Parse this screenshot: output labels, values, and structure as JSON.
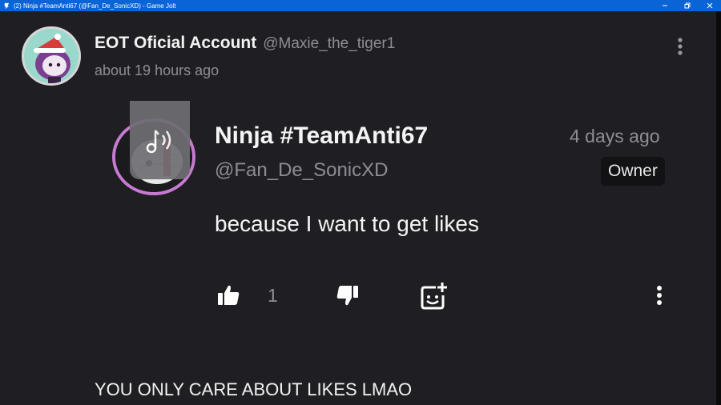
{
  "window": {
    "title": "(2) Ninja #TeamAnti67 (@Fan_De_SonicXD) - Game Jolt"
  },
  "post": {
    "author_name": "EOT Oficial Account",
    "author_handle": "@Maxie_the_tiger1",
    "timestamp": "about 19 hours ago"
  },
  "reply": {
    "author_name": "Ninja #TeamAnti67",
    "author_handle": "@Fan_De_SonicXD",
    "timestamp": "4 days ago",
    "badge": "Owner",
    "body": "because I want to get likes",
    "like_count": "1"
  },
  "comment": {
    "text": "YOU ONLY CARE ABOUT LIKES LMAO"
  },
  "colors": {
    "background": "#1f1e22",
    "titlebar": "#0a64d6",
    "muted_text": "#8e8d95",
    "avatar_ring": "#c77ad1"
  },
  "icons": {
    "app": "game-jolt-icon",
    "minimize": "minimize-icon",
    "restore": "restore-icon",
    "close": "close-icon",
    "audio": "audio-note-icon",
    "like": "thumbs-up-icon",
    "dislike": "thumbs-down-icon",
    "react": "add-reaction-icon",
    "more": "more-vertical-icon"
  }
}
